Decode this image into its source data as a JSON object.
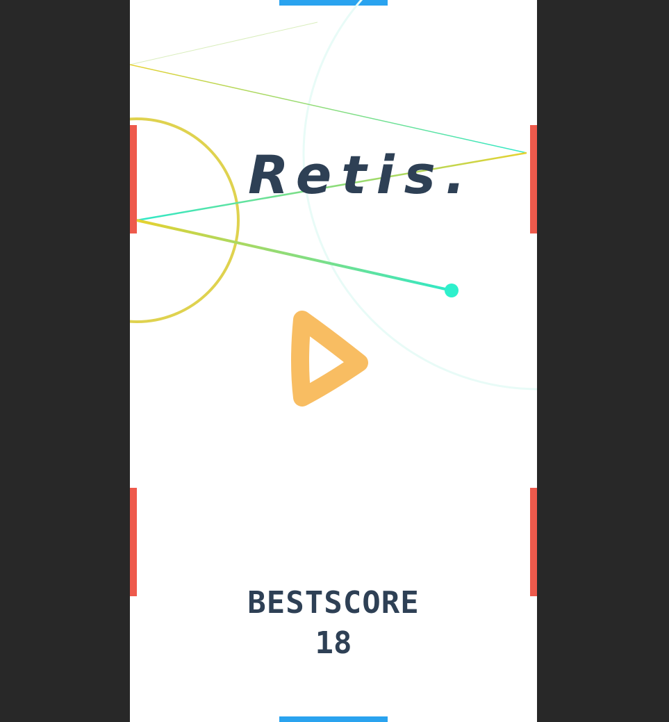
{
  "game": {
    "title": "Retis.",
    "best_score_label": "BESTSCORE",
    "best_score_value": "18"
  },
  "colors": {
    "background": "#282828",
    "board": "#ffffff",
    "goal_paddle": "#2aa3ef",
    "side_paddle": "#ee5a4c",
    "text": "#2e4055",
    "play_button": "#f8bd62",
    "trail_start": "#e7d12f",
    "trail_end": "#2ee8c8",
    "ball": "#2ef0cc",
    "ring": "#dccd3c"
  },
  "icons": {
    "play": "play-triangle-icon",
    "ball": "ball-icon"
  }
}
